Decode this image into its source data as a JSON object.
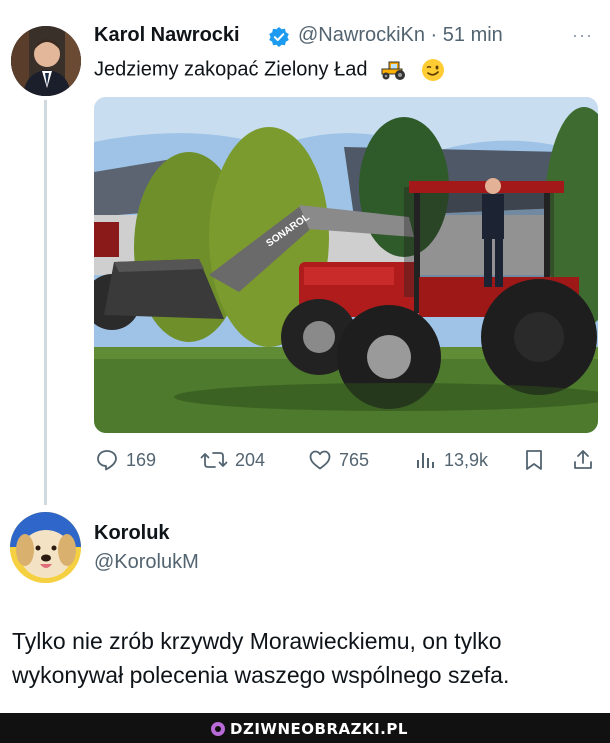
{
  "tweet": {
    "author_name": "Karol Nawrocki",
    "handle_time": "@NawrockiKn · 51 min",
    "more": "···",
    "text": "Jedziemy zakopać Zielony Ład",
    "emojis": [
      "tractor-emoji",
      "winking-face-emoji"
    ],
    "image_label": "SONAROL",
    "stats": {
      "replies": "169",
      "retweets": "204",
      "likes": "765",
      "views": "13,9k"
    }
  },
  "reply": {
    "author_name": "Koroluk",
    "handle": "@KorolukM",
    "text": "Tylko nie zrób krzywdy Morawieckiemu, on tylko wykonywał polecenia waszego wspólnego szefa."
  },
  "watermark": {
    "text": "DZIWNEOBRAZKI.PL"
  },
  "colors": {
    "text": "#0f1419",
    "secondary": "#536471",
    "verified": "#1d9bf0",
    "thread_line": "#cfd9de",
    "footer": "#111111"
  }
}
